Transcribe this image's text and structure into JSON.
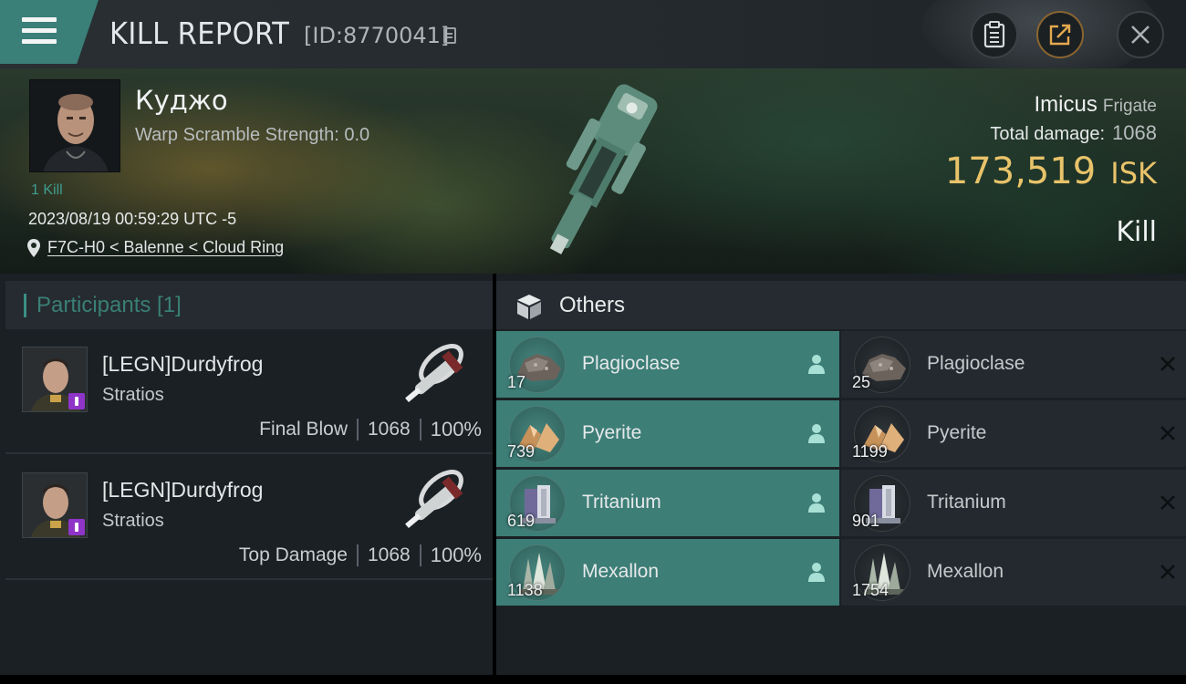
{
  "header": {
    "title": "KILL REPORT",
    "report_id": "[ID:8770041]"
  },
  "victim": {
    "name": "Куджо",
    "warp_scramble": "Warp Scramble Strength: 0.0",
    "kill_count": "1 Kill",
    "timestamp": "2023/08/19 00:59:29 UTC -5",
    "location": "F7C-H0 < Balenne < Cloud Ring",
    "ship_name": "Imicus",
    "ship_class": "Frigate",
    "total_damage_label": "Total damage:",
    "total_damage": "1068",
    "isk_value": "173,519",
    "isk_currency": "ISK",
    "result": "Kill"
  },
  "participants": {
    "header": "Participants [1]",
    "rows": [
      {
        "name": "[LEGN]Durdyfrog",
        "ship": "Stratios",
        "role": "Final Blow",
        "damage": "1068",
        "percent": "100%"
      },
      {
        "name": "[LEGN]Durdyfrog",
        "ship": "Stratios",
        "role": "Top Damage",
        "damage": "1068",
        "percent": "100%"
      }
    ]
  },
  "others": {
    "header": "Others",
    "dropped": [
      {
        "name": "Plagioclase",
        "qty": "17",
        "icon": "plagioclase-ore-icon"
      },
      {
        "name": "Pyerite",
        "qty": "739",
        "icon": "pyerite-icon"
      },
      {
        "name": "Tritanium",
        "qty": "619",
        "icon": "tritanium-icon"
      },
      {
        "name": "Mexallon",
        "qty": "1138",
        "icon": "mexallon-icon"
      }
    ],
    "destroyed": [
      {
        "name": "Plagioclase",
        "qty": "25",
        "icon": "plagioclase-ore-icon"
      },
      {
        "name": "Pyerite",
        "qty": "1199",
        "icon": "pyerite-icon"
      },
      {
        "name": "Tritanium",
        "qty": "901",
        "icon": "tritanium-icon"
      },
      {
        "name": "Mexallon",
        "qty": "1754",
        "icon": "mexallon-icon"
      }
    ]
  },
  "colors": {
    "accent_teal": "#3d7e77",
    "isk_gold": "#e8c36a",
    "corp_badge": "#8f34c9"
  }
}
